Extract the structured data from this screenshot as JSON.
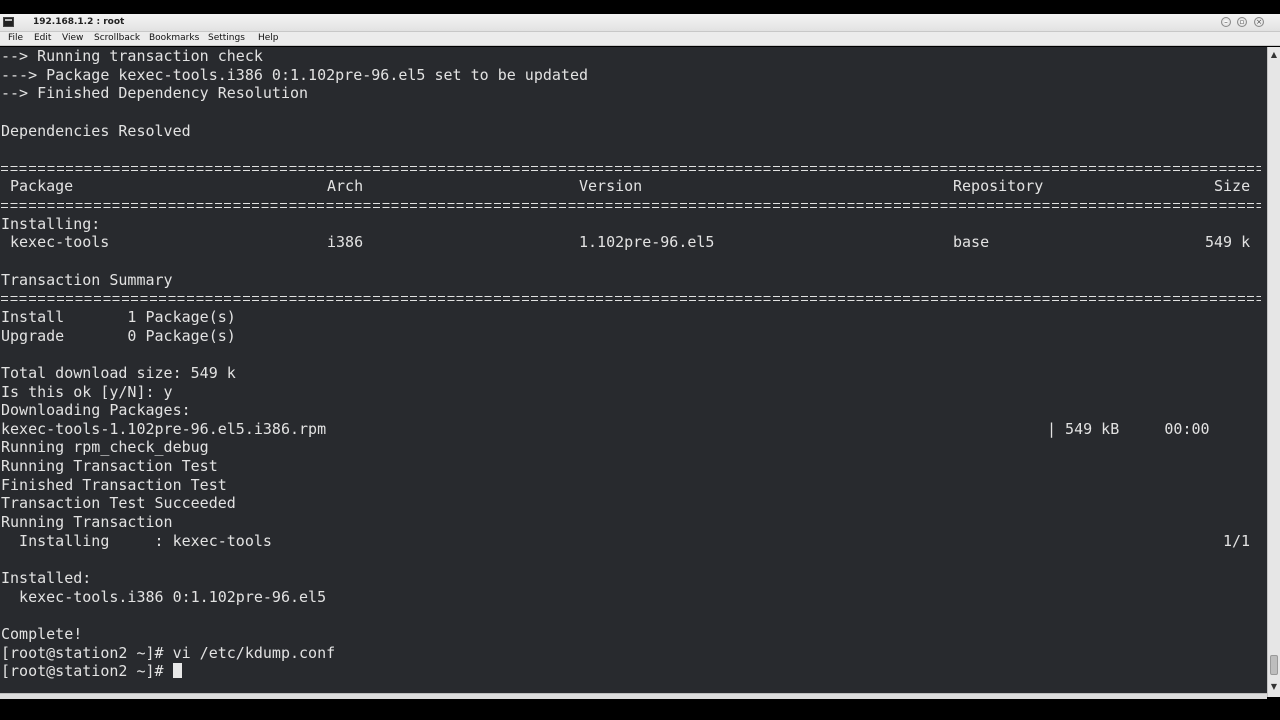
{
  "window": {
    "title": "192.168.1.2 : root",
    "minimize_glyph": "–",
    "maximize_glyph": "▫",
    "close_glyph": "×"
  },
  "menu": {
    "file": "File",
    "edit": "Edit",
    "view": "View",
    "scrollback": "Scrollback",
    "bookmarks": "Bookmarks",
    "settings": "Settings",
    "help": "Help"
  },
  "terminal": {
    "l01": "--> Running transaction check",
    "l02": "---> Package kexec-tools.i386 0:1.102pre-96.el5 set to be updated",
    "l03": "--> Finished Dependency Resolution",
    "l05": "Dependencies Resolved",
    "table_header": {
      "package": "Package",
      "arch": "Arch",
      "version": "Version",
      "repository": "Repository",
      "size": "Size"
    },
    "installing_label": "Installing:",
    "table_row": {
      "package": "kexec-tools",
      "arch": "i386",
      "version": "1.102pre-96.el5",
      "repository": "base",
      "size": "549 k"
    },
    "summary_title": "Transaction Summary",
    "install_summary": "Install       1 Package(s)",
    "upgrade_summary": "Upgrade       0 Package(s)",
    "total_download": "Total download size: 549 k",
    "confirm_prompt": "Is this ok [y/N]: y",
    "downloading": "Downloading Packages:",
    "rpm_file": "kexec-tools-1.102pre-96.el5.i386.rpm",
    "download_progress": "| 549 kB     00:00",
    "rpm_check": "Running rpm_check_debug",
    "test_running": "Running Transaction Test",
    "test_finished": "Finished Transaction Test",
    "test_succeeded": "Transaction Test Succeeded",
    "transaction_running": "Running Transaction",
    "installing_step": "  Installing     : kexec-tools",
    "installing_count": "1/1",
    "installed_label": "Installed:",
    "installed_pkg": "  kexec-tools.i386 0:1.102pre-96.el5",
    "complete": "Complete!",
    "prompt1": "[root@station2 ~]# vi /etc/kdump.conf",
    "prompt2": "[root@station2 ~]# "
  },
  "scrollbar": {
    "up_glyph": "▲",
    "down_glyph": "▼"
  }
}
